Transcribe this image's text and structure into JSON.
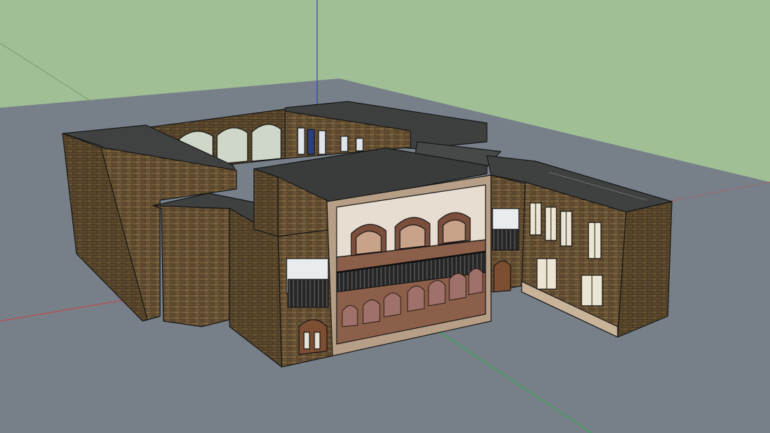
{
  "app": {
    "view": "3d-model-viewport",
    "scene": "brick-courtyard-building"
  },
  "colors": {
    "sky": "#a1bf94",
    "ground": "#778089",
    "axis_red": "#d23b3b",
    "axis_green": "#2fa84a",
    "axis_blue": "#2f3fd6",
    "brick": "#6e5737",
    "brick_dark": "#5b482d",
    "roof": "#3b3d3c",
    "edge": "#151515"
  }
}
